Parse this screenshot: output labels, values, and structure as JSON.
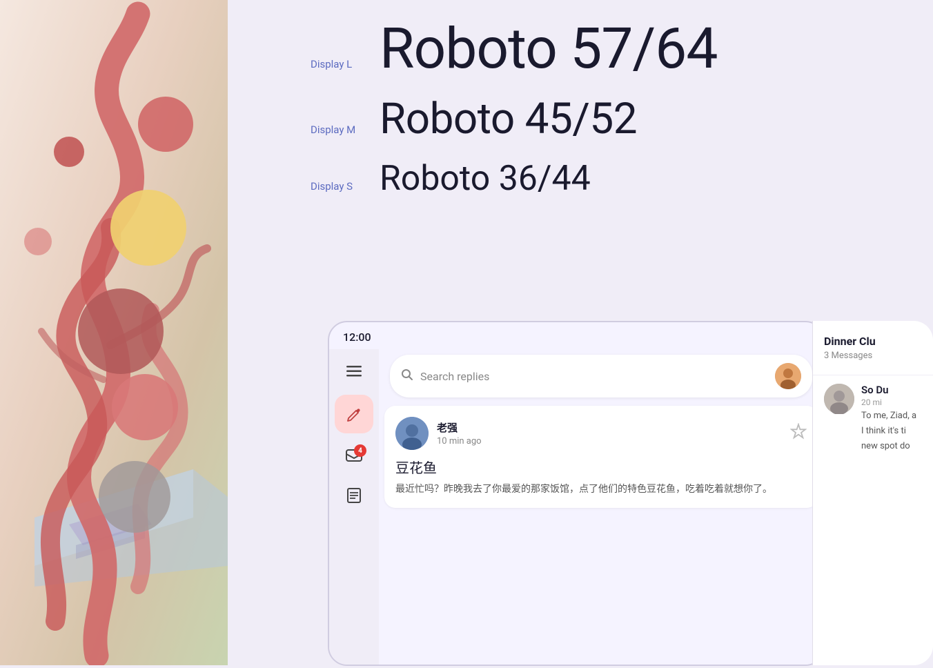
{
  "background_color": "#f0edf7",
  "illustration": {
    "panel_bg_start": "#f5e0da",
    "panel_bg_end": "#c8d4b8"
  },
  "typography": {
    "display_l_label": "Display L",
    "display_l_text": "Roboto 57/64",
    "display_m_label": "Display M",
    "display_m_text": "Roboto 45/52",
    "display_s_label": "Display S",
    "display_s_text": "Roboto 36/44"
  },
  "phone": {
    "status_time": "12:00",
    "search_placeholder": "Search replies",
    "sidebar_icons": [
      "☰",
      "✏",
      "📋",
      "≡"
    ],
    "badge_count": "4",
    "message": {
      "sender_name": "老强",
      "time_ago": "10 min ago",
      "title": "豆花鱼",
      "preview": "最近忙吗？昨晚我去了你最爱的那家饭馆，点了他们的特色豆花鱼，吃着吃着就想你了。"
    },
    "right_panel": {
      "title": "Dinner Clu",
      "subtitle": "3 Messages",
      "person_name": "So Du",
      "person_time": "20 mi",
      "person_preview_line1": "To me, Ziad, a",
      "person_preview_line2": "I think it's ti",
      "person_preview_line3": "new spot do"
    }
  }
}
